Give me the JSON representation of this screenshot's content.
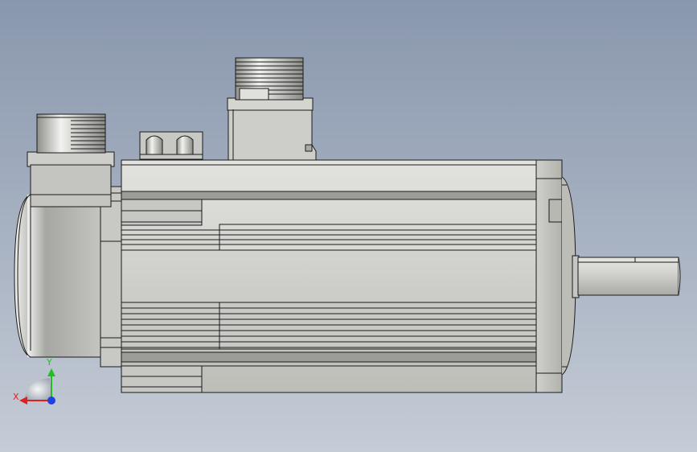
{
  "viewport": {
    "background_top": "#8997ad",
    "background_bottom": "#c5ccd6"
  },
  "model": {
    "subject": "servo motor",
    "view": "side",
    "body_color": "#cfcfcb",
    "edge_color": "#1a1a1a"
  },
  "triad": {
    "x_label": "X",
    "y_label": "Y",
    "x_color": "#e02020",
    "y_color": "#20c020",
    "z_color": "#2040e0"
  }
}
